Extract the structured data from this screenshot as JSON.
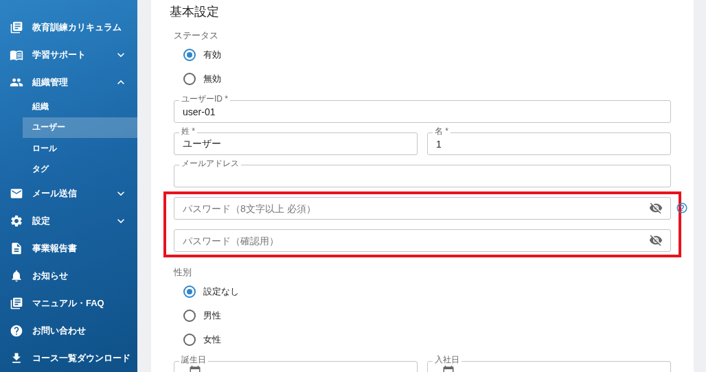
{
  "sidebar": {
    "items": [
      {
        "label": "教育訓練カリキュラム"
      },
      {
        "label": "学習サポート",
        "expanded": false
      },
      {
        "label": "組織管理",
        "expanded": true,
        "children": [
          {
            "label": "組織",
            "selected": false
          },
          {
            "label": "ユーザー",
            "selected": true
          },
          {
            "label": "ロール",
            "selected": false
          },
          {
            "label": "タグ",
            "selected": false
          }
        ]
      },
      {
        "label": "メール送信",
        "expanded": false
      },
      {
        "label": "設定",
        "expanded": false
      },
      {
        "label": "事業報告書"
      },
      {
        "label": "お知らせ"
      },
      {
        "label": "マニュアル・FAQ"
      },
      {
        "label": "お問い合わせ"
      },
      {
        "label": "コース一覧ダウンロード"
      }
    ]
  },
  "form": {
    "title": "基本設定",
    "fields": [
      {
        "kind": "radio-group",
        "label": "ステータス",
        "options": [
          {
            "label": "有効",
            "selected": true
          },
          {
            "label": "無効",
            "selected": false
          }
        ]
      },
      {
        "kind": "text",
        "label": "ユーザーID *",
        "value": "user-01"
      },
      {
        "kind": "pair",
        "fields": [
          {
            "kind": "text",
            "label": "姓 *",
            "value": "ユーザー"
          },
          {
            "kind": "text",
            "label": "名 *",
            "value": "1"
          }
        ]
      },
      {
        "kind": "text",
        "label": "メールアドレス"
      },
      {
        "kind": "group",
        "highlighted": true,
        "fields": [
          {
            "kind": "password",
            "placeholder": "パスワード（8文字以上 必須）",
            "help": true
          },
          {
            "kind": "password",
            "placeholder": "パスワード（確認用）",
            "help": false
          }
        ]
      },
      {
        "kind": "radio-group",
        "label": "性別",
        "options": [
          {
            "label": "設定なし",
            "selected": true
          },
          {
            "label": "男性",
            "selected": false
          },
          {
            "label": "女性",
            "selected": false
          }
        ]
      },
      {
        "kind": "pair",
        "fields": [
          {
            "kind": "date",
            "label": "誕生日"
          },
          {
            "kind": "date",
            "label": "入社日"
          }
        ]
      }
    ]
  }
}
